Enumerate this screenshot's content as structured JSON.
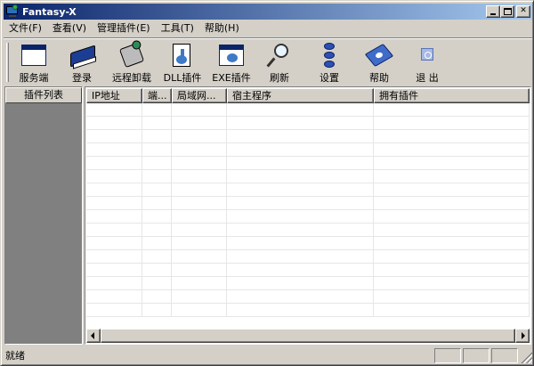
{
  "window": {
    "title": "Fantasy-X"
  },
  "menu": [
    "文件(F)",
    "查看(V)",
    "管理插件(E)",
    "工具(T)",
    "帮助(H)"
  ],
  "toolbar": [
    {
      "label": "服务端",
      "icon": "server-window-icon"
    },
    {
      "label": "登录",
      "icon": "login-book-icon"
    },
    {
      "label": "远程卸载",
      "icon": "remote-uninstall-icon"
    },
    {
      "label": "DLL插件",
      "icon": "dll-plugin-icon"
    },
    {
      "label": "EXE插件",
      "icon": "exe-plugin-icon"
    },
    {
      "label": "刷新",
      "icon": "magnifier-icon"
    },
    {
      "label": "设置",
      "icon": "gears-icon"
    },
    {
      "label": "帮助",
      "icon": "help-book-icon"
    },
    {
      "label": "退 出",
      "icon": "exit-icon"
    }
  ],
  "left_panel": {
    "header": "插件列表"
  },
  "list": {
    "columns": [
      "IP地址",
      "端...",
      "局域网...",
      "宿主程序",
      "拥有插件"
    ]
  },
  "status": {
    "text": "就绪"
  }
}
